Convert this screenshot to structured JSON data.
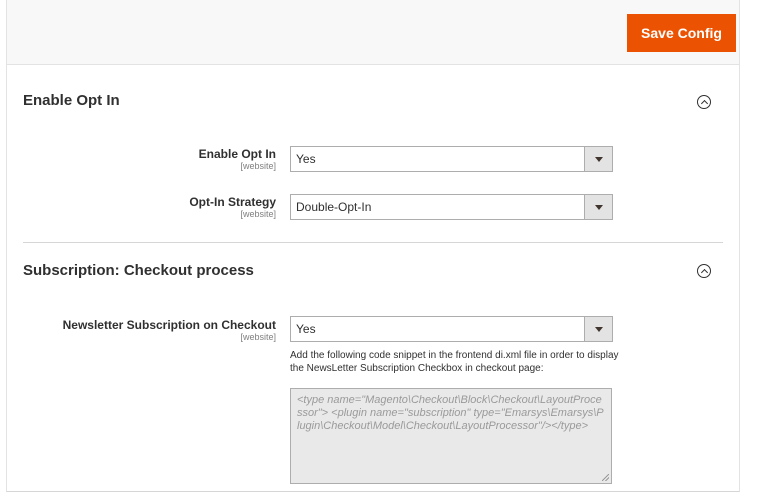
{
  "toolbar": {
    "save_label": "Save Config",
    "accent_color": "#eb5202"
  },
  "sections": [
    {
      "title": "Enable Opt In",
      "collapse_icon": "chevron-up-circle-icon",
      "fields": [
        {
          "label": "Enable Opt In",
          "scope": "[website]",
          "value": "Yes"
        },
        {
          "label": "Opt-In Strategy",
          "scope": "[website]",
          "value": "Double-Opt-In"
        }
      ]
    },
    {
      "title": "Subscription: Checkout process",
      "collapse_icon": "chevron-up-circle-icon",
      "fields": [
        {
          "label": "Newsletter Subscription on Checkout",
          "scope": "[website]",
          "value": "Yes",
          "note": "Add the following code snippet in the frontend di.xml file in order to display the NewsLetter Subscription Checkbox in checkout page:",
          "code_placeholder": "<type name=\"Magento\\Checkout\\Block\\Checkout\\LayoutProcessor\"> <plugin name=\"subscription\" type=\"Emarsys\\Emarsys\\Plugin\\Checkout\\Model\\Checkout\\LayoutProcessor\"/></type>"
        }
      ]
    }
  ]
}
